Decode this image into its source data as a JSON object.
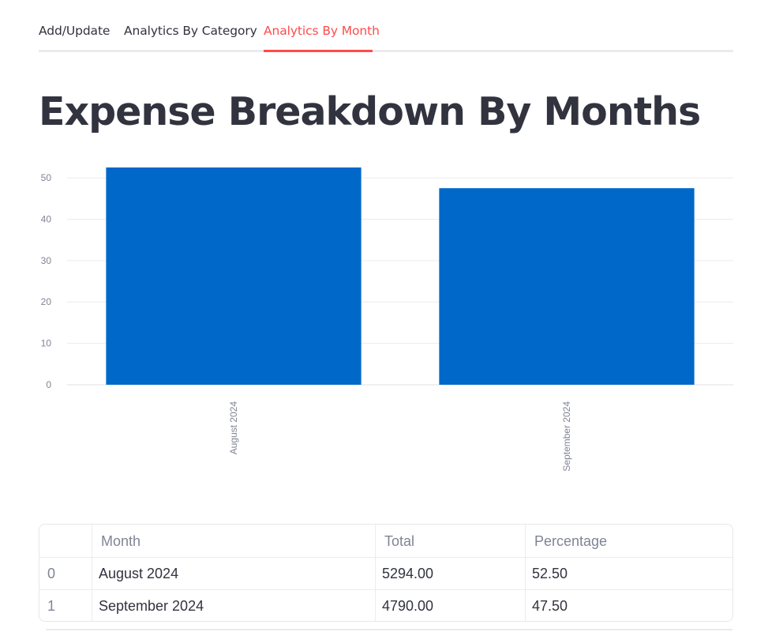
{
  "tabs": [
    {
      "label": "Add/Update",
      "active": false
    },
    {
      "label": "Analytics By Category",
      "active": false
    },
    {
      "label": "Analytics By Month",
      "active": true
    }
  ],
  "title": "Expense Breakdown By Months",
  "colors": {
    "accent": "#ff4b4b",
    "bar": "#0068c9",
    "text": "#31333f",
    "muted": "#808495"
  },
  "chart_data": {
    "type": "bar",
    "categories": [
      "August 2024",
      "September 2024"
    ],
    "values": [
      52.5,
      47.5
    ],
    "ylim": [
      0,
      52.5
    ],
    "yticks": [
      0,
      10,
      20,
      30,
      40,
      50
    ],
    "grid": true,
    "title": "",
    "xlabel": "",
    "ylabel": ""
  },
  "table": {
    "columns": [
      "",
      "Month",
      "Total",
      "Percentage"
    ],
    "rows": [
      {
        "index": "0",
        "month": "August 2024",
        "total": "5294.00",
        "percentage": "52.50"
      },
      {
        "index": "1",
        "month": "September 2024",
        "total": "4790.00",
        "percentage": "47.50"
      }
    ]
  }
}
